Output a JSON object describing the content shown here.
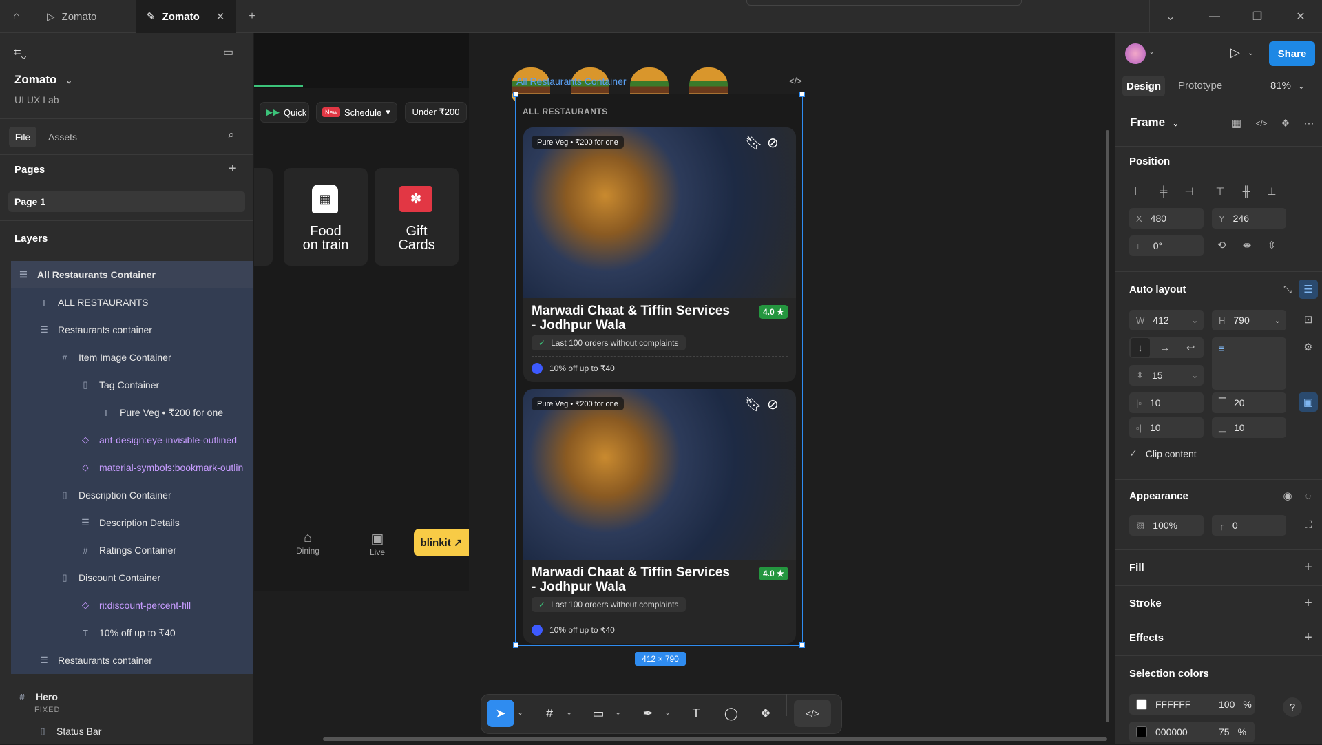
{
  "tabs": [
    {
      "label": "Zomato",
      "icon": "play-icon"
    },
    {
      "label": "Zomato",
      "icon": "pen-icon",
      "active": true
    }
  ],
  "left_panel": {
    "project": "Zomato",
    "team": "UI UX Lab",
    "tab_file": "File",
    "tab_assets": "Assets",
    "pages_title": "Pages",
    "page1": "Page 1",
    "layers_title": "Layers",
    "layers": [
      {
        "label": "All Restaurants Container",
        "icon": "autolayout-icon",
        "indent": 0,
        "selected": true
      },
      {
        "label": "ALL RESTAURANTS",
        "icon": "text-icon",
        "indent": 1
      },
      {
        "label": "Restaurants container",
        "icon": "autolayout-icon",
        "indent": 1
      },
      {
        "label": "Item Image Container",
        "icon": "frame-icon",
        "indent": 2
      },
      {
        "label": "Tag Container",
        "icon": "autolayout-h-icon",
        "indent": 3
      },
      {
        "label": "Pure Veg • ₹200 for one",
        "icon": "text-icon",
        "indent": 4
      },
      {
        "label": "ant-design:eye-invisible-outlined",
        "icon": "component-icon",
        "indent": 3,
        "component": true
      },
      {
        "label": "material-symbols:bookmark-outlin",
        "icon": "component-icon",
        "indent": 3,
        "component": true
      },
      {
        "label": "Description Container",
        "icon": "autolayout-h-icon",
        "indent": 2
      },
      {
        "label": "Description Details",
        "icon": "autolayout-icon",
        "indent": 3
      },
      {
        "label": "Ratings Container",
        "icon": "frame-icon",
        "indent": 3
      },
      {
        "label": "Discount Container",
        "icon": "autolayout-h-icon",
        "indent": 2
      },
      {
        "label": "ri:discount-percent-fill",
        "icon": "component-icon",
        "indent": 3,
        "component": true
      },
      {
        "label": "10% off up to ₹40",
        "icon": "text-icon",
        "indent": 3
      },
      {
        "label": "Restaurants container",
        "icon": "autolayout-icon",
        "indent": 1
      }
    ],
    "hero": "Hero",
    "fixed": "FIXED",
    "status_bar": "Status Bar"
  },
  "canvas": {
    "food_chips": [
      "Fastfood",
      "Fastfood",
      "Fastfood",
      "Fastfood"
    ],
    "filters": {
      "quick": "Quick",
      "new_badge": "New",
      "schedule": "Schedule",
      "under": "Under ₹200"
    },
    "tiles": [
      {
        "line1": "Food",
        "line2": "on train"
      },
      {
        "line1": "Gift",
        "line2": "Cards"
      }
    ],
    "bottom_nav": {
      "dining": "Dining",
      "live": "Live",
      "blinkit": "blinkit ↗"
    },
    "frame_label": "All Restaurants Container",
    "frame_size": "412 × 790",
    "section_title": "ALL RESTAURANTS",
    "cards": [
      {
        "tag": "Pure Veg • ₹200 for one",
        "name1": "Marwadi Chaat & Tiffin Services",
        "name2": "- Jodhpur Wala",
        "rating": "4.0 ★",
        "note": "Last 100 orders without complaints",
        "discount": "10% off up to ₹40"
      },
      {
        "tag": "Pure Veg • ₹200 for one",
        "name1": "Marwadi Chaat & Tiffin Services",
        "name2": "- Jodhpur Wala",
        "rating": "4.0 ★",
        "note": "Last 100 orders without complaints",
        "discount": "10% off up to ₹40"
      }
    ]
  },
  "right_panel": {
    "share": "Share",
    "tab_design": "Design",
    "tab_prototype": "Prototype",
    "zoom": "81%",
    "frame": "Frame",
    "position": "Position",
    "x_label": "X",
    "x": "480",
    "y_label": "Y",
    "y": "246",
    "rotation": "0°",
    "auto_layout": "Auto layout",
    "w_label": "W",
    "w": "412",
    "h_label": "H",
    "h": "790",
    "gap": "15",
    "pad_left": "10",
    "pad_top": "20",
    "pad_right": "10",
    "pad_bottom": "10",
    "clip": "Clip content",
    "appearance": "Appearance",
    "opacity": "100%",
    "radius": "0",
    "fill": "Fill",
    "stroke": "Stroke",
    "effects": "Effects",
    "selection_colors": "Selection colors",
    "colors": [
      {
        "hex": "FFFFFF",
        "opacity": "100",
        "pct": "%",
        "swatch": "#ffffff"
      },
      {
        "hex": "000000",
        "opacity": "75",
        "pct": "%",
        "swatch": "#000000"
      }
    ],
    "help": "?"
  }
}
